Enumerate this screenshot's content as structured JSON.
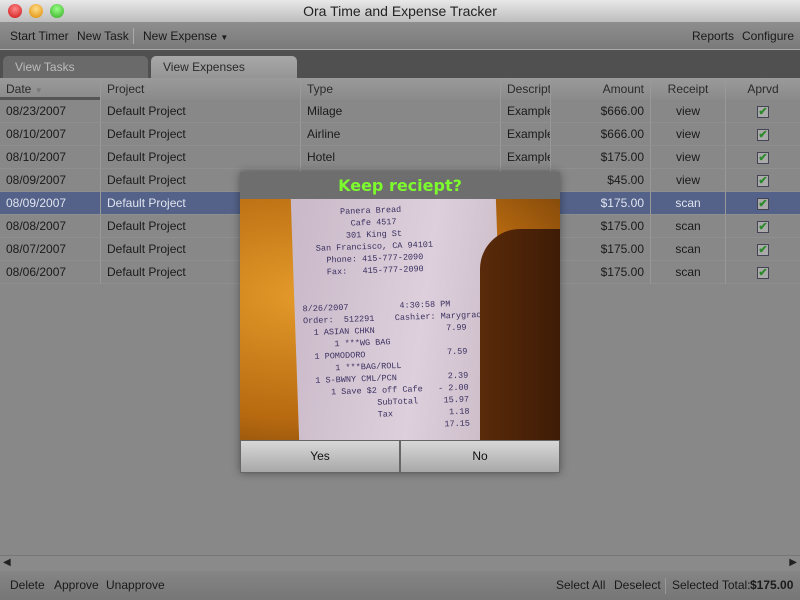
{
  "window": {
    "title": "Ora Time and Expense Tracker"
  },
  "toolbar": {
    "start_timer": "Start Timer",
    "new_task": "New Task",
    "new_expense": "New Expense",
    "reports": "Reports",
    "configure": "Configure"
  },
  "tabs": [
    {
      "label": "View Tasks"
    },
    {
      "label": "View Expenses"
    }
  ],
  "columns": [
    "Date",
    "Project",
    "Type",
    "Description",
    "Amount",
    "Receipt",
    "Aprvd"
  ],
  "column_display": {
    "description": "Descripti"
  },
  "rows": [
    {
      "date": "08/23/2007",
      "project": "Default Project",
      "type": "Milage",
      "desc": "Example",
      "amount": "$666.00",
      "receipt": "view",
      "approved": true
    },
    {
      "date": "08/10/2007",
      "project": "Default Project",
      "type": "Airline",
      "desc": "Example",
      "amount": "$666.00",
      "receipt": "view",
      "approved": true
    },
    {
      "date": "08/10/2007",
      "project": "Default Project",
      "type": "Hotel",
      "desc": "Example",
      "amount": "$175.00",
      "receipt": "view",
      "approved": true
    },
    {
      "date": "08/09/2007",
      "project": "Default Project",
      "type": "",
      "desc": "",
      "amount": "$45.00",
      "receipt": "view",
      "approved": true
    },
    {
      "date": "08/09/2007",
      "project": "Default Project",
      "type": "",
      "desc": "",
      "amount": "$175.00",
      "receipt": "scan",
      "approved": true,
      "selected": true
    },
    {
      "date": "08/08/2007",
      "project": "Default Project",
      "type": "",
      "desc": "",
      "amount": "$175.00",
      "receipt": "scan",
      "approved": true
    },
    {
      "date": "08/07/2007",
      "project": "Default Project",
      "type": "",
      "desc": "",
      "amount": "$175.00",
      "receipt": "scan",
      "approved": true
    },
    {
      "date": "08/06/2007",
      "project": "Default Project",
      "type": "",
      "desc": "",
      "amount": "$175.00",
      "receipt": "scan",
      "approved": true
    }
  ],
  "bottom": {
    "delete": "Delete",
    "approve": "Approve",
    "unapprove": "Unapprove",
    "select_all": "Select All",
    "deselect": "Deselect",
    "total_label": "Selected Total:",
    "total_value": "$175.00"
  },
  "dialog": {
    "title": "Keep reciept?",
    "yes": "Yes",
    "no": "No",
    "receipt_text": "        Panera Bread\n          Cafe 4517\n         301 King St\n   San Francisco, CA 94101\n     Phone: 415-777-2090\n     Fax:   415-777-2090\n\n\n8/26/2007          4:30:58 PM\nOrder:  512291    Cashier: Marygrace\n  1 ASIAN CHKN              7.99\n      1 ***WG BAG\n  1 POMODORO                7.59\n      1 ***BAG/ROLL\n  1 S-BWNY CML/PCN          2.39\n     1 Save $2 off Cafe   - 2.00\n              SubTotal     15.97\n              Tax           1.18\n                           17.15"
  },
  "colors": {
    "accent_green": "#7cfc2c",
    "selection": "#54628a"
  }
}
